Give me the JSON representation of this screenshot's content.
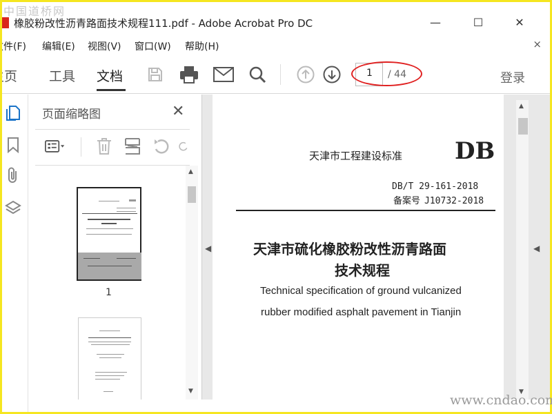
{
  "watermarks": {
    "top": "中国道桥网",
    "bottom": "www.cndao.com"
  },
  "window": {
    "title": "橡胶粉改性沥青路面技术规程111.pdf - Adobe Acrobat Pro DC",
    "minimize": "—",
    "maximize": "☐",
    "close": "✕"
  },
  "menu": {
    "items": [
      "文件(F)",
      "编辑(E)",
      "视图(V)",
      "窗口(W)",
      "帮助(H)"
    ],
    "close": "×"
  },
  "toolbar": {
    "tabs": [
      "主页",
      "工具",
      "文档"
    ],
    "active_tab": "文档",
    "page_current": "1",
    "page_total": "/ 44",
    "login": "登录",
    "icons": [
      "save-icon",
      "print-icon",
      "email-icon",
      "search-icon",
      "page-up-icon",
      "page-down-icon"
    ]
  },
  "side_rail": {
    "icons": [
      "page-thumbnails-icon",
      "bookmarks-icon",
      "attachments-icon",
      "layers-icon"
    ]
  },
  "panel": {
    "title": "页面缩略图",
    "close": "✕",
    "tools": [
      "thumbnail-options-icon",
      "delete-icon",
      "crop-icon",
      "undo-icon",
      "redo-icon"
    ],
    "thumbnails": [
      {
        "label": "1"
      },
      {
        "label": ""
      }
    ]
  },
  "document": {
    "header": "天津市工程建设标准",
    "db_mark": "DB",
    "code": "DB/T 29-161-2018",
    "reg_label": "备案号",
    "reg_code": "J10732-2018",
    "title_line1": "天津市硫化橡胶粉改性沥青路面",
    "title_line2": "技术规程",
    "en_line1": "Technical specification of ground vulcanized",
    "en_line2": "rubber modified asphalt pavement in Tianjin"
  },
  "colors": {
    "frame_yellow": "#f5e620",
    "annotation_red": "#e02020",
    "app_red": "#d9261c"
  }
}
